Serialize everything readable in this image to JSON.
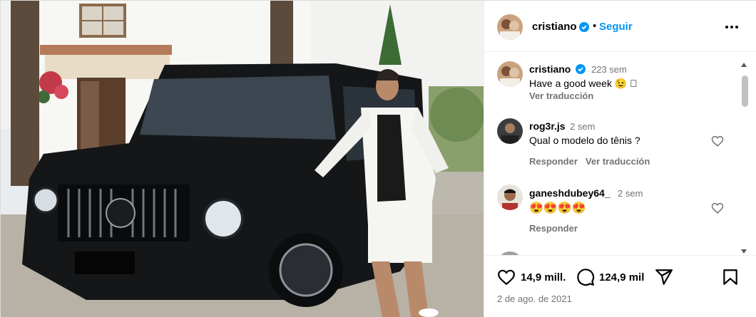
{
  "post": {
    "username": "cristiano",
    "follow_label": "Seguir",
    "separator": "•"
  },
  "comments": [
    {
      "username": "cristiano",
      "time": "223 sem",
      "text": "Have a good week 😉 🏽",
      "action": "Ver traducción"
    },
    {
      "username": "rog3r.js",
      "time": "2 sem",
      "text": "Qual o modelo do tênis ?",
      "reply": "Responder",
      "translate": "Ver traducción"
    },
    {
      "username": "ganeshdubey64_",
      "time": "2 sem",
      "text": "😍😍😍😍",
      "reply": "Responder"
    }
  ],
  "stats": {
    "likes": "14,9 mill.",
    "comments": "124,9 mil",
    "date": "2 de ago. de 2021"
  },
  "icons": {
    "verified": "verified-badge-icon",
    "more": "more-options-icon",
    "like": "heart-icon",
    "comment": "comment-bubble-icon",
    "share": "paper-plane-icon",
    "save": "bookmark-icon"
  },
  "colors": {
    "accent": "#0095f6",
    "verified": "#0095f6",
    "muted": "#737373"
  }
}
